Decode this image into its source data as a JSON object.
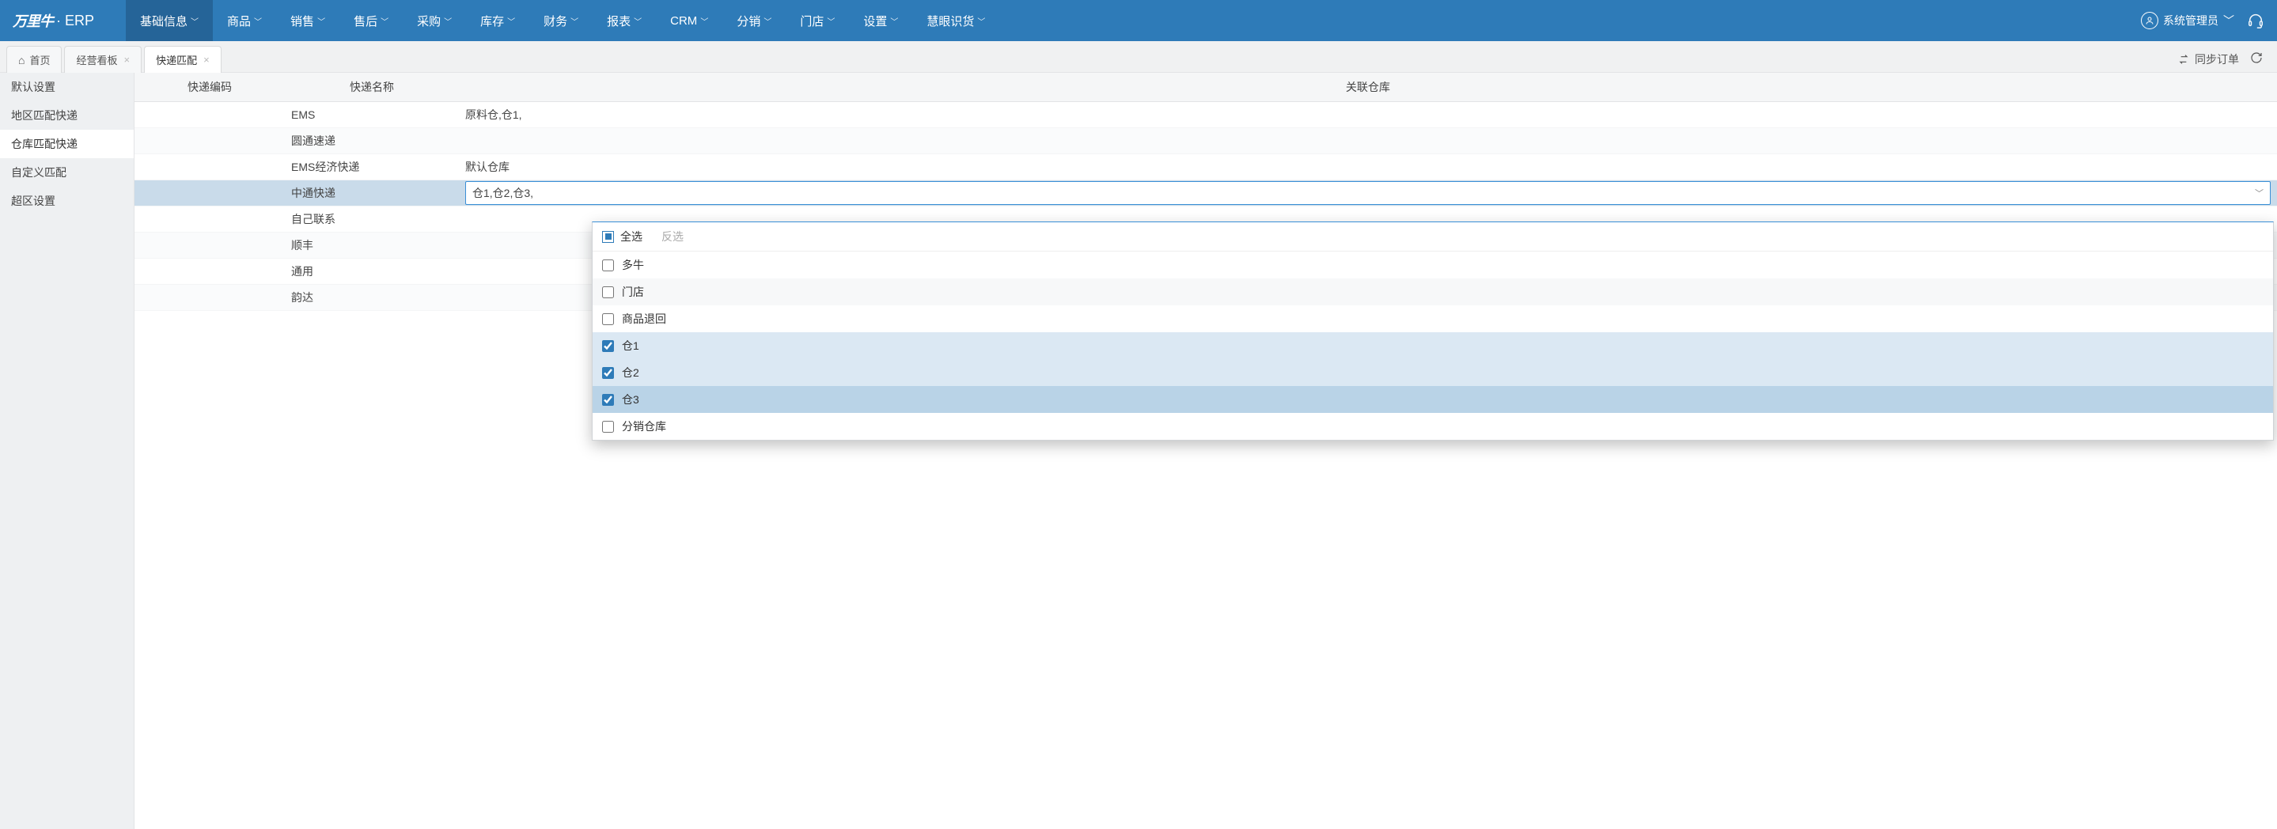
{
  "brand": {
    "logo": "万里牛",
    "suffix": "· ERP"
  },
  "nav": {
    "items": [
      {
        "label": "基础信息",
        "active": true
      },
      {
        "label": "商品"
      },
      {
        "label": "销售"
      },
      {
        "label": "售后"
      },
      {
        "label": "采购"
      },
      {
        "label": "库存"
      },
      {
        "label": "财务"
      },
      {
        "label": "报表"
      },
      {
        "label": "CRM"
      },
      {
        "label": "分销"
      },
      {
        "label": "门店"
      },
      {
        "label": "设置"
      },
      {
        "label": "慧眼识货"
      }
    ],
    "user_label": "系统管理员"
  },
  "tabs": {
    "items": [
      {
        "label": "首页",
        "home": true,
        "closable": false
      },
      {
        "label": "经营看板",
        "closable": true
      },
      {
        "label": "快递匹配",
        "closable": true,
        "active": true
      }
    ],
    "sync_label": "同步订单"
  },
  "sidebar": {
    "items": [
      {
        "label": "默认设置"
      },
      {
        "label": "地区匹配快递"
      },
      {
        "label": "仓库匹配快递",
        "active": true
      },
      {
        "label": "自定义匹配"
      },
      {
        "label": "超区设置"
      }
    ]
  },
  "table": {
    "headers": {
      "code": "快递编码",
      "name": "快递名称",
      "warehouse": "关联仓库"
    },
    "rows": [
      {
        "code": "",
        "name": "EMS",
        "warehouse": "原料仓,仓1,"
      },
      {
        "code": "",
        "name": "圆通速递",
        "warehouse": ""
      },
      {
        "code": "",
        "name": "EMS经济快递",
        "warehouse": "默认仓库"
      },
      {
        "code": "",
        "name": "中通快递",
        "warehouse": "仓1,仓2,仓3,",
        "editing": true
      },
      {
        "code": "",
        "name": "自己联系",
        "warehouse": ""
      },
      {
        "code": "",
        "name": "顺丰",
        "warehouse": ""
      },
      {
        "code": "",
        "name": "通用",
        "warehouse": ""
      },
      {
        "code": "",
        "name": "韵达",
        "warehouse": ""
      }
    ]
  },
  "dropdown": {
    "select_all_label": "全选",
    "inverse_label": "反选",
    "options": [
      {
        "label": "多牛",
        "checked": false
      },
      {
        "label": "门店",
        "checked": false
      },
      {
        "label": "商品退回",
        "checked": false
      },
      {
        "label": "仓1",
        "checked": true
      },
      {
        "label": "仓2",
        "checked": true
      },
      {
        "label": "仓3",
        "checked": true,
        "hover": true
      },
      {
        "label": "分销仓库",
        "checked": false
      }
    ]
  }
}
